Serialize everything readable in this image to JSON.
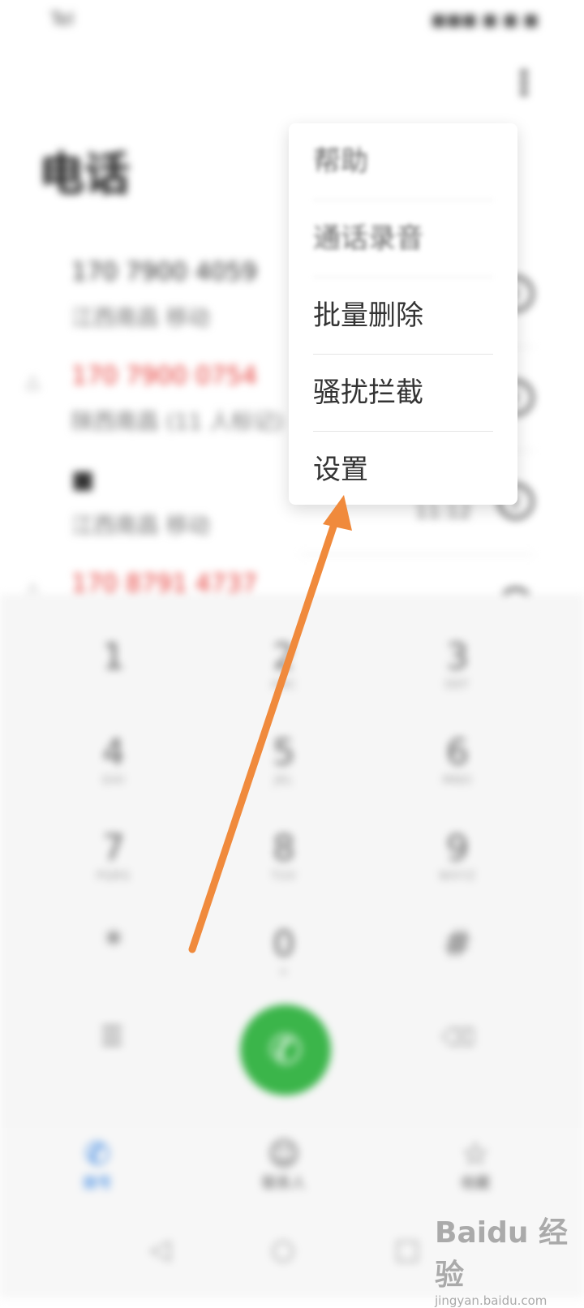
{
  "status_bar": {
    "time": "Tel",
    "right": "■■■ ■ ■ ■"
  },
  "header": {
    "title": "电话",
    "more_icon": "more-vertical-icon"
  },
  "call_log": [
    {
      "number": "170 7900 4059",
      "sub": "江西南昌 移动",
      "missed": false,
      "time": ""
    },
    {
      "number": "170 7900 0754",
      "sub": "陕西南昌 (11 人标记)",
      "missed": true,
      "time": ""
    },
    {
      "number": "■",
      "sub": "江西南昌 移动",
      "missed": false,
      "time": "11:12"
    },
    {
      "number": "170 8791 4737",
      "sub": "",
      "missed": true,
      "time": ""
    }
  ],
  "menu": {
    "items": [
      {
        "label": "帮助",
        "blurred": true
      },
      {
        "label": "通话录音",
        "blurred": true
      },
      {
        "label": "批量删除",
        "blurred": false
      },
      {
        "label": "骚扰拦截",
        "blurred": false
      },
      {
        "label": "设置",
        "blurred": false
      }
    ]
  },
  "dialpad": {
    "keys": [
      {
        "digit": "1",
        "letters": ""
      },
      {
        "digit": "2",
        "letters": "ABC"
      },
      {
        "digit": "3",
        "letters": "DEF"
      },
      {
        "digit": "4",
        "letters": "GHI"
      },
      {
        "digit": "5",
        "letters": "JKL"
      },
      {
        "digit": "6",
        "letters": "MNO"
      },
      {
        "digit": "7",
        "letters": "PQRS"
      },
      {
        "digit": "8",
        "letters": "TUV"
      },
      {
        "digit": "9",
        "letters": "WXYZ"
      },
      {
        "digit": "*",
        "letters": ""
      },
      {
        "digit": "0",
        "letters": "+"
      },
      {
        "digit": "#",
        "letters": ""
      }
    ],
    "call_icon": "phone-icon",
    "call_glyph": "✆",
    "left_glyph": "☰",
    "backspace_glyph": "⌫"
  },
  "tabs": [
    {
      "label": "拨号",
      "icon": "phone-icon",
      "glyph": "✆",
      "active": true
    },
    {
      "label": "联系人",
      "icon": "contacts-icon",
      "glyph": "☺",
      "active": false
    },
    {
      "label": "收藏",
      "icon": "star-icon",
      "glyph": "☆",
      "active": false
    }
  ],
  "navbar": {
    "back_glyph": "◁",
    "home_glyph": "○",
    "recent_glyph": "□"
  },
  "watermark": {
    "brand": "Baidu 经验",
    "sub": "jingyan.baidu.com"
  },
  "annotation": {
    "color": "#f08a3c"
  }
}
